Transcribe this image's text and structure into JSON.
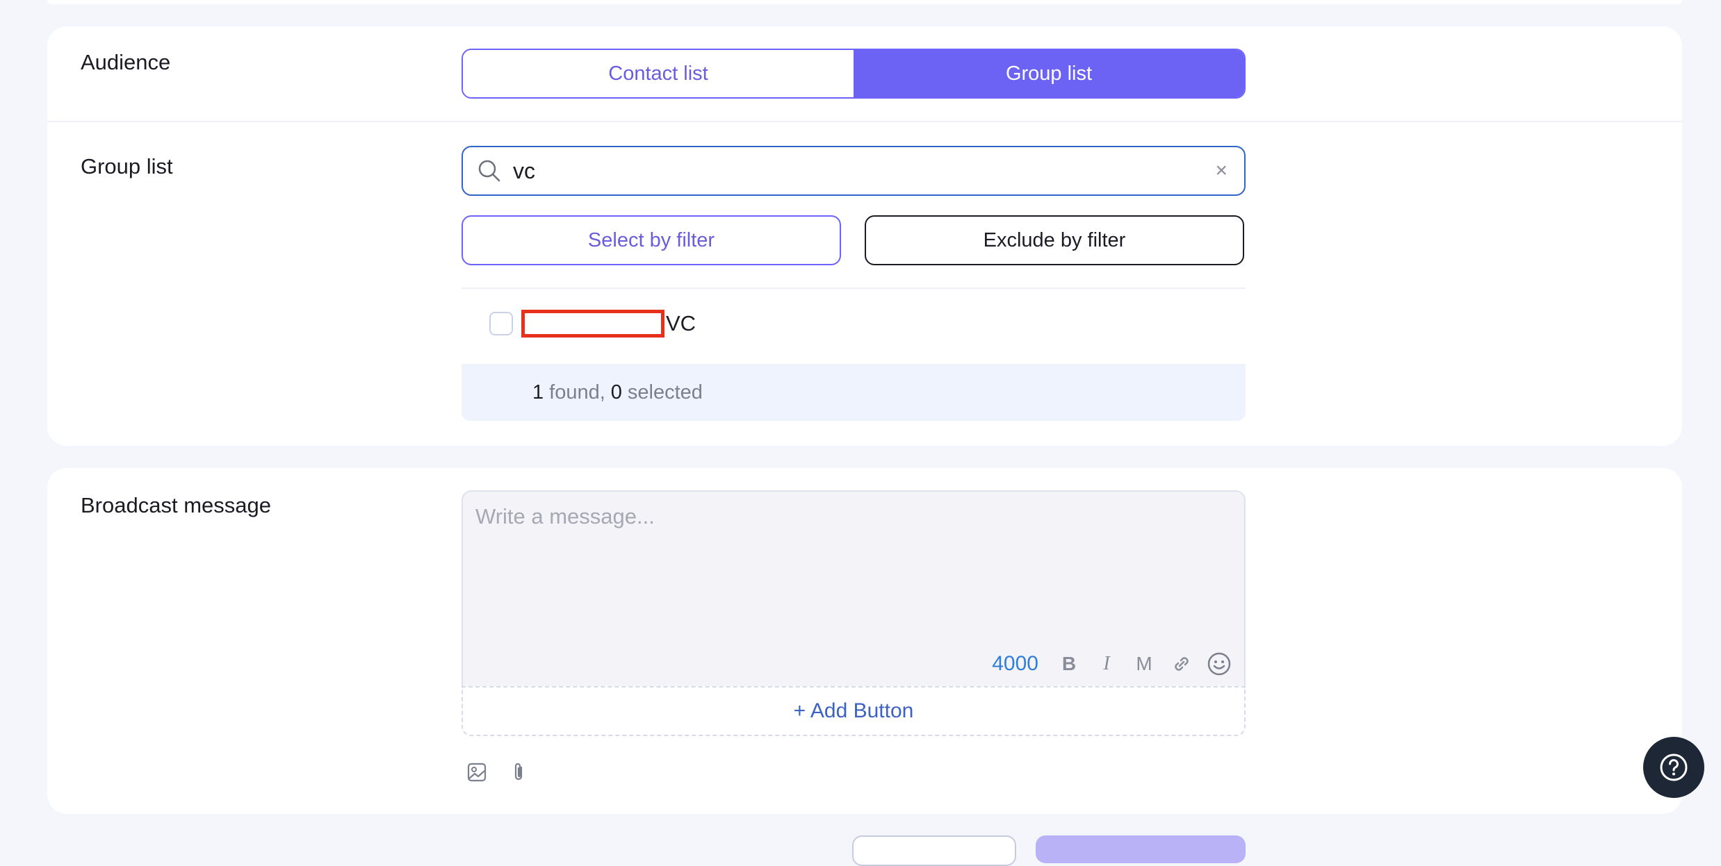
{
  "audience": {
    "label": "Audience",
    "tabs": [
      {
        "label": "Contact list",
        "active": false
      },
      {
        "label": "Group list",
        "active": true
      }
    ]
  },
  "group_list": {
    "label": "Group list",
    "search_value": "vc",
    "clear_icon": "×",
    "select_filter_label": "Select by filter",
    "exclude_filter_label": "Exclude by filter",
    "items": [
      {
        "suffix": "VC",
        "checked": false,
        "redacted": true
      }
    ],
    "found_count": "1",
    "found_text": "found,",
    "selected_count": "0",
    "selected_text": "selected"
  },
  "broadcast": {
    "label": "Broadcast message",
    "placeholder": "Write a message...",
    "char_limit": "4000",
    "toolbar": [
      "bold-icon",
      "italic-icon",
      "monospace-icon",
      "link-icon",
      "emoji-icon"
    ],
    "bold_glyph": "B",
    "italic_glyph": "I",
    "mono_glyph": "M",
    "add_button_label": "+ Add Button",
    "attachments": [
      "image-icon",
      "paperclip-icon"
    ]
  },
  "help": {
    "icon": "question-icon"
  },
  "colors": {
    "accent": "#6c63f4",
    "accent_text": "#6a5ddd",
    "search_border": "#2f64c8",
    "redaction": "#e8311c",
    "counter": "#2f7fd8",
    "link": "#3b62c4"
  }
}
